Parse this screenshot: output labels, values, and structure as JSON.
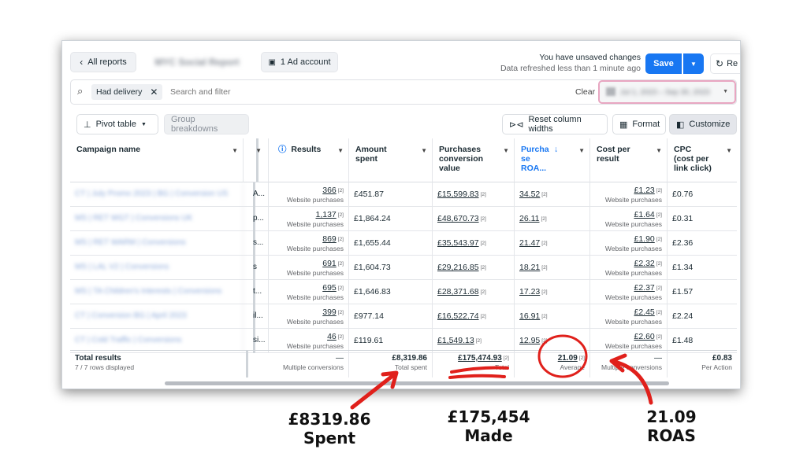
{
  "header": {
    "back_label": "All reports",
    "report_name": "MYC Social Report",
    "ad_account": "1 Ad account",
    "unsaved": "You have unsaved changes",
    "refreshed": "Data refreshed less than 1 minute ago",
    "save": "Save",
    "refresh_partial": "Re"
  },
  "filter": {
    "chip": "Had delivery",
    "placeholder": "Search and filter",
    "clear": "Clear",
    "date_range": "Jul 1, 2023 – Sep 30, 2023"
  },
  "toolbar": {
    "pivot": "Pivot table",
    "group": "Group breakdowns",
    "reset": "Reset column widths",
    "format": "Format",
    "customize": "Customize"
  },
  "columns": {
    "campaign": "Campaign name",
    "results": "Results",
    "amount": "Amount spent",
    "pcv": "Purchases conversion value",
    "roas": "Purcha se ROA...",
    "cpr": "Cost per result",
    "cpc": "CPC (cost per link click)"
  },
  "rows": [
    {
      "name": "CT | July Promo 2023 | BG | Conversion US",
      "frag": "A...",
      "results": "366",
      "results_sub": "Website purchases",
      "amount": "£451.87",
      "pcv": "£15,599.83",
      "roas": "34.52",
      "cpr": "£1.23",
      "cpr_sub": "Website purchases",
      "cpc": "£0.76"
    },
    {
      "name": "MS | RET WGT | Conversions UK",
      "frag": "p...",
      "results": "1,137",
      "results_sub": "Website purchases",
      "amount": "£1,864.24",
      "pcv": "£48,670.73",
      "roas": "26.11",
      "cpr": "£1.64",
      "cpr_sub": "Website purchases",
      "cpc": "£0.31"
    },
    {
      "name": "MS | RET WARM | Conversions",
      "frag": "s...",
      "results": "869",
      "results_sub": "Website purchases",
      "amount": "£1,655.44",
      "pcv": "£35,543.97",
      "roas": "21.47",
      "cpr": "£1.90",
      "cpr_sub": "Website purchases",
      "cpc": "£2.36"
    },
    {
      "name": "MS | LAL V2 | Conversions",
      "frag": "s",
      "results": "691",
      "results_sub": "Website purchases",
      "amount": "£1,604.73",
      "pcv": "£29,216.85",
      "roas": "18.21",
      "cpr": "£2.32",
      "cpr_sub": "Website purchases",
      "cpc": "£1.34"
    },
    {
      "name": "MS | TA Children's Interests | Conversions",
      "frag": "t...",
      "results": "695",
      "results_sub": "Website purchases",
      "amount": "£1,646.83",
      "pcv": "£28,371.68",
      "roas": "17.23",
      "cpr": "£2.37",
      "cpr_sub": "Website purchases",
      "cpc": "£1.57"
    },
    {
      "name": "CT | Conversion BG | April 2023",
      "frag": "il...",
      "results": "399",
      "results_sub": "Website purchases",
      "amount": "£977.14",
      "pcv": "£16,522.74",
      "roas": "16.91",
      "cpr": "£2.45",
      "cpr_sub": "Website purchases",
      "cpc": "£2.24"
    },
    {
      "name": "CT | Cold Traffic | Conversions",
      "frag": "si...",
      "results": "46",
      "results_sub": "Website purchases",
      "amount": "£119.61",
      "pcv": "£1,549.13",
      "roas": "12.95",
      "cpr": "£2.60",
      "cpr_sub": "Website purchases",
      "cpc": "£1.48"
    }
  ],
  "totals": {
    "label": "Total results",
    "rows_displayed": "7 / 7 rows displayed",
    "results": "—",
    "results_sub": "Multiple conversions",
    "amount": "£8,319.86",
    "amount_sub": "Total spent",
    "pcv": "£175,474.93",
    "pcv_sub": "Total",
    "roas": "21.09",
    "roas_sub": "Average",
    "cpr": "—",
    "cpr_sub": "Multiple conversions",
    "cpc": "£0.83",
    "cpc_sub": "Per Action"
  },
  "annotations": {
    "spent_amount": "£8319.86",
    "spent_label": "Spent",
    "made_amount": "£175,454",
    "made_label": "Made",
    "roas_amount": "21.09",
    "roas_label": "ROAS"
  },
  "colors": {
    "accent": "#1877f2",
    "annotation": "#e0201b",
    "highlight_border": "#e8a6c1"
  }
}
